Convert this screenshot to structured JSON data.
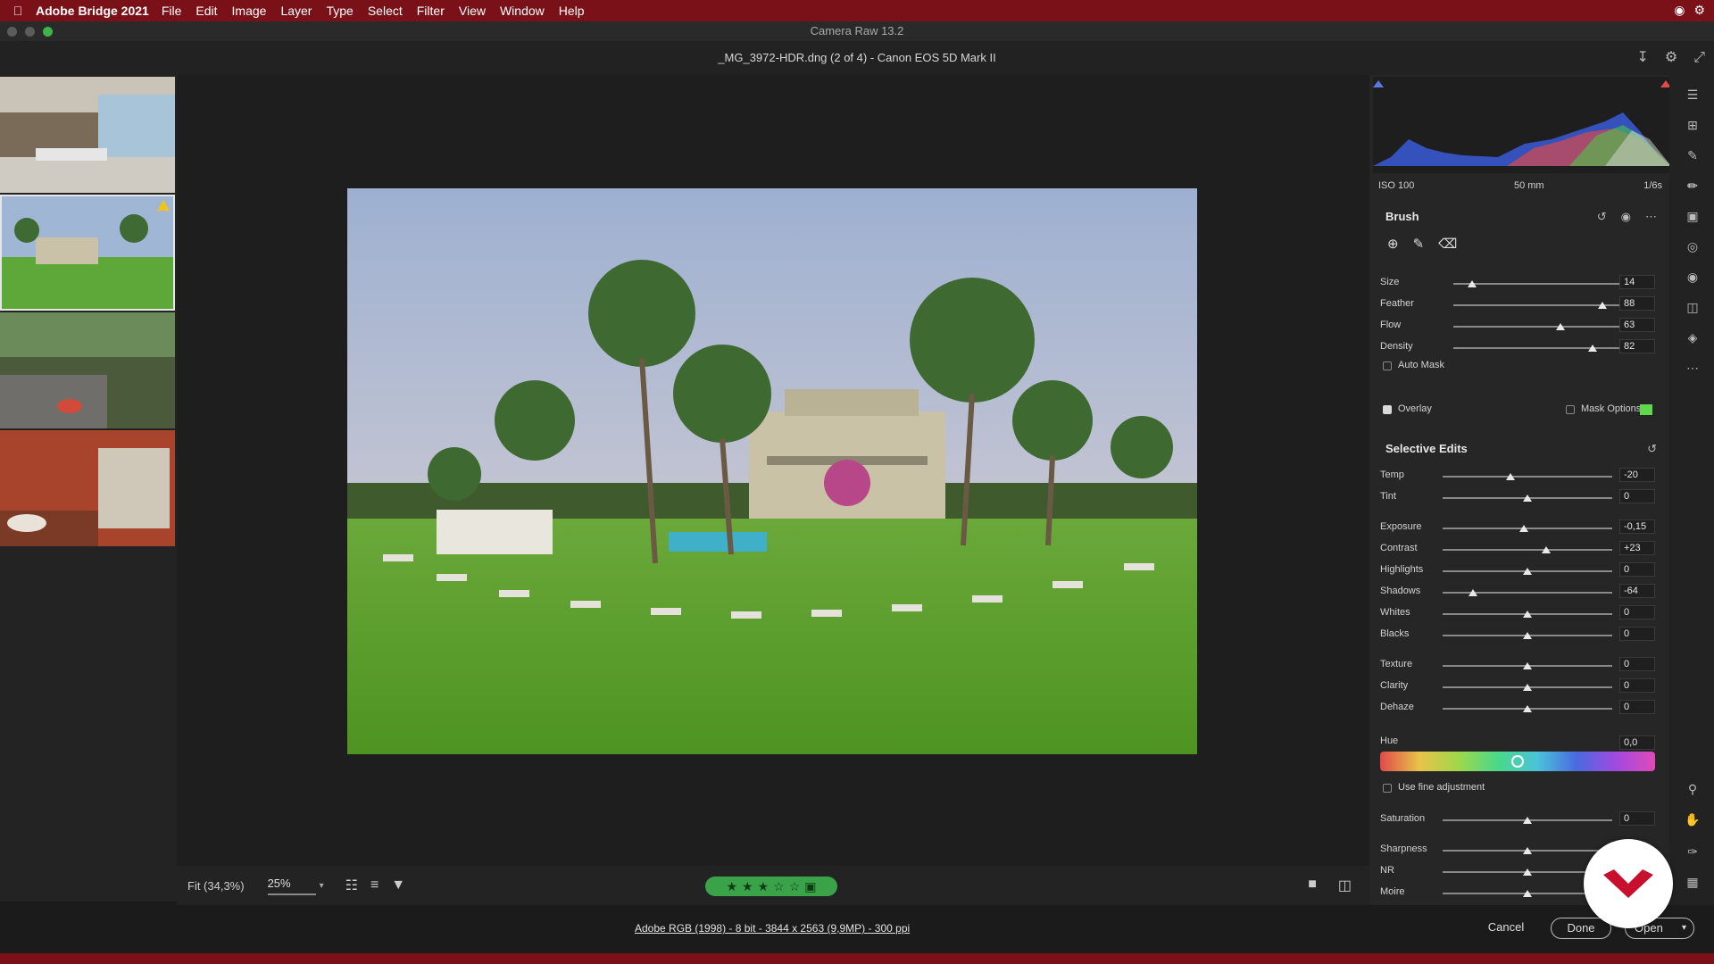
{
  "menubar": {
    "app_name": "Adobe Bridge 2021",
    "items": [
      "File",
      "Edit",
      "Image",
      "Layer",
      "Type",
      "Select",
      "Filter",
      "View",
      "Window",
      "Help"
    ]
  },
  "window": {
    "title": "Camera Raw 13.2",
    "file_label": "_MG_3972-HDR.dng (2 of 4)  -  Canon EOS 5D Mark II"
  },
  "histogram_info": {
    "iso": "ISO 100",
    "focal": "50 mm",
    "shutter": "1/6s"
  },
  "brush": {
    "title": "Brush",
    "sliders": [
      {
        "label": "Size",
        "value": "14",
        "pos": 0.11
      },
      {
        "label": "Feather",
        "value": "88",
        "pos": 0.88
      },
      {
        "label": "Flow",
        "value": "63",
        "pos": 0.63
      },
      {
        "label": "Density",
        "value": "82",
        "pos": 0.82
      }
    ],
    "auto_mask": "Auto Mask",
    "overlay": "Overlay",
    "mask_options": "Mask Options",
    "mask_color": "#5fd94a"
  },
  "selective_edits": {
    "title": "Selective Edits",
    "sliders": [
      {
        "label": "Temp",
        "value": "-20",
        "pos": 0.4
      },
      {
        "label": "Tint",
        "value": "0",
        "pos": 0.5
      },
      {
        "label": "Exposure",
        "value": "-0,15",
        "pos": 0.48
      },
      {
        "label": "Contrast",
        "value": "+23",
        "pos": 0.61
      },
      {
        "label": "Highlights",
        "value": "0",
        "pos": 0.5
      },
      {
        "label": "Shadows",
        "value": "-64",
        "pos": 0.18
      },
      {
        "label": "Whites",
        "value": "0",
        "pos": 0.5
      },
      {
        "label": "Blacks",
        "value": "0",
        "pos": 0.5
      },
      {
        "label": "Texture",
        "value": "0",
        "pos": 0.5
      },
      {
        "label": "Clarity",
        "value": "0",
        "pos": 0.5
      },
      {
        "label": "Dehaze",
        "value": "0",
        "pos": 0.5
      }
    ],
    "hue_label": "Hue",
    "hue_value": "0,0",
    "hue_pos": 0.5,
    "fine_adjustment": "Use fine adjustment",
    "lower_sliders": [
      {
        "label": "Saturation",
        "value": "0",
        "pos": 0.5
      },
      {
        "label": "Sharpness",
        "value": "",
        "pos": 0.5
      },
      {
        "label": "NR",
        "value": "",
        "pos": 0.5
      },
      {
        "label": "Moire",
        "value": "",
        "pos": 0.5
      }
    ]
  },
  "bottom_toolbar": {
    "fit_label": "Fit (34,3%)",
    "zoom_value": "25%",
    "rating_stars": 3
  },
  "status": {
    "workflow": "Adobe RGB (1998) - 8 bit - 3844 x 2563 (9,9MP) - 300 ppi",
    "cancel": "Cancel",
    "done": "Done",
    "open": "Open"
  },
  "colors": {
    "menubar": "#7a1118",
    "rating": "#3aa34a"
  }
}
